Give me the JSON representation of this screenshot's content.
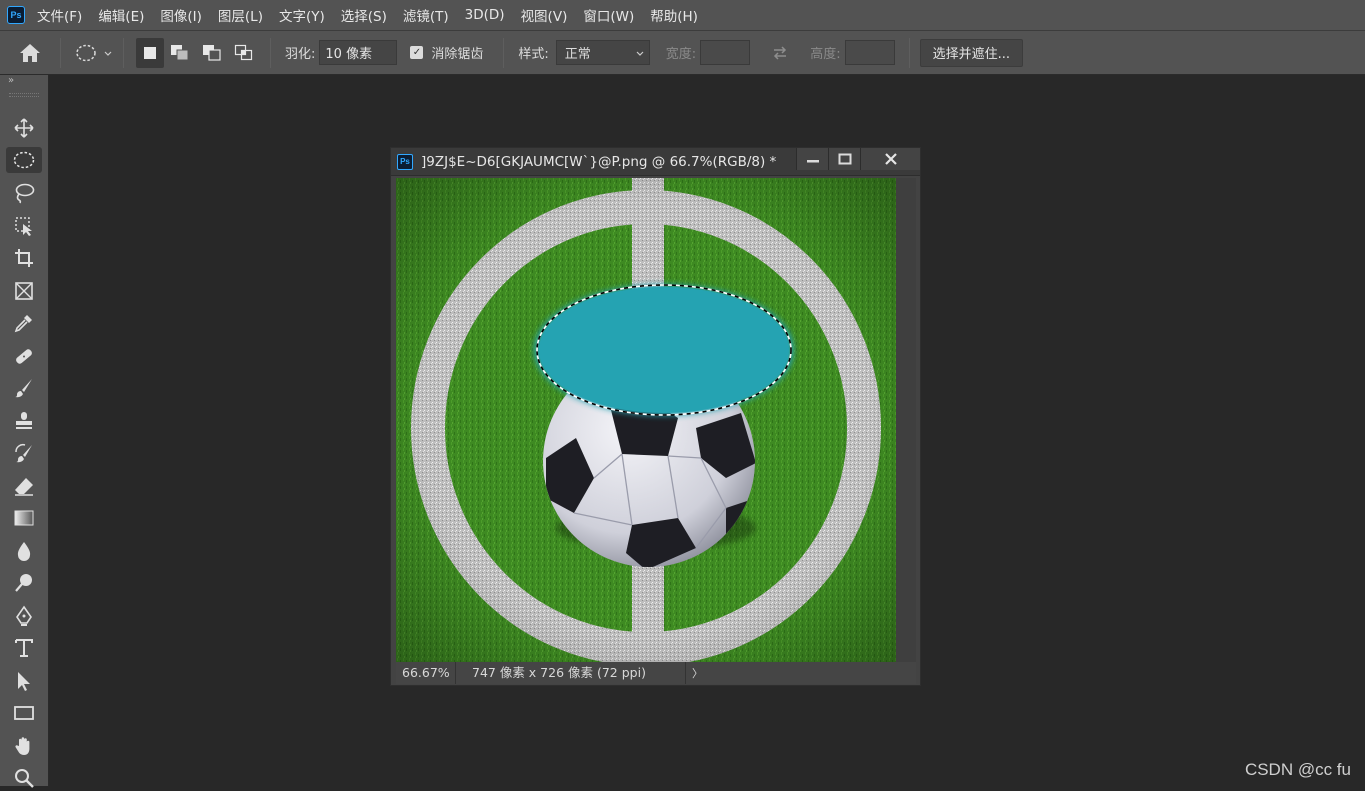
{
  "app": {
    "logo_text": "Ps"
  },
  "menu": [
    "文件(F)",
    "编辑(E)",
    "图像(I)",
    "图层(L)",
    "文字(Y)",
    "选择(S)",
    "滤镜(T)",
    "3D(D)",
    "视图(V)",
    "窗口(W)",
    "帮助(H)"
  ],
  "options": {
    "feather_label": "羽化:",
    "feather_value": "10 像素",
    "antialias_label": "消除锯齿",
    "antialias_checked": true,
    "style_label": "样式:",
    "style_value": "正常",
    "width_label": "宽度:",
    "height_label": "高度:",
    "select_mask_button": "选择并遮住..."
  },
  "toolbar": {
    "collapse_glyph": "»",
    "tools": [
      "move-tool",
      "elliptical-marquee-tool",
      "lasso-tool",
      "object-selection-tool",
      "crop-tool",
      "frame-tool",
      "eyedropper-tool",
      "healing-brush-tool",
      "brush-tool",
      "clone-stamp-tool",
      "history-brush-tool",
      "eraser-tool",
      "gradient-tool",
      "blur-tool",
      "dodge-tool",
      "pen-tool",
      "type-tool",
      "path-selection-tool",
      "rectangle-tool",
      "hand-tool",
      "zoom-tool"
    ],
    "active_tool": "elliptical-marquee-tool"
  },
  "document": {
    "title": "]9ZJ$E~D6[GKJAUMC[W`}@P.png @ 66.7%(RGB/8) *",
    "zoom": "66.67%",
    "info": "747 像素 x 726 像素 (72 ppi)",
    "status_arrow": "〉"
  },
  "colors": {
    "grass": "#3f8a22",
    "selection_fill": "#25a3b2",
    "panel": "#535353",
    "workspace": "#282828"
  },
  "watermark": "CSDN @cc fu"
}
